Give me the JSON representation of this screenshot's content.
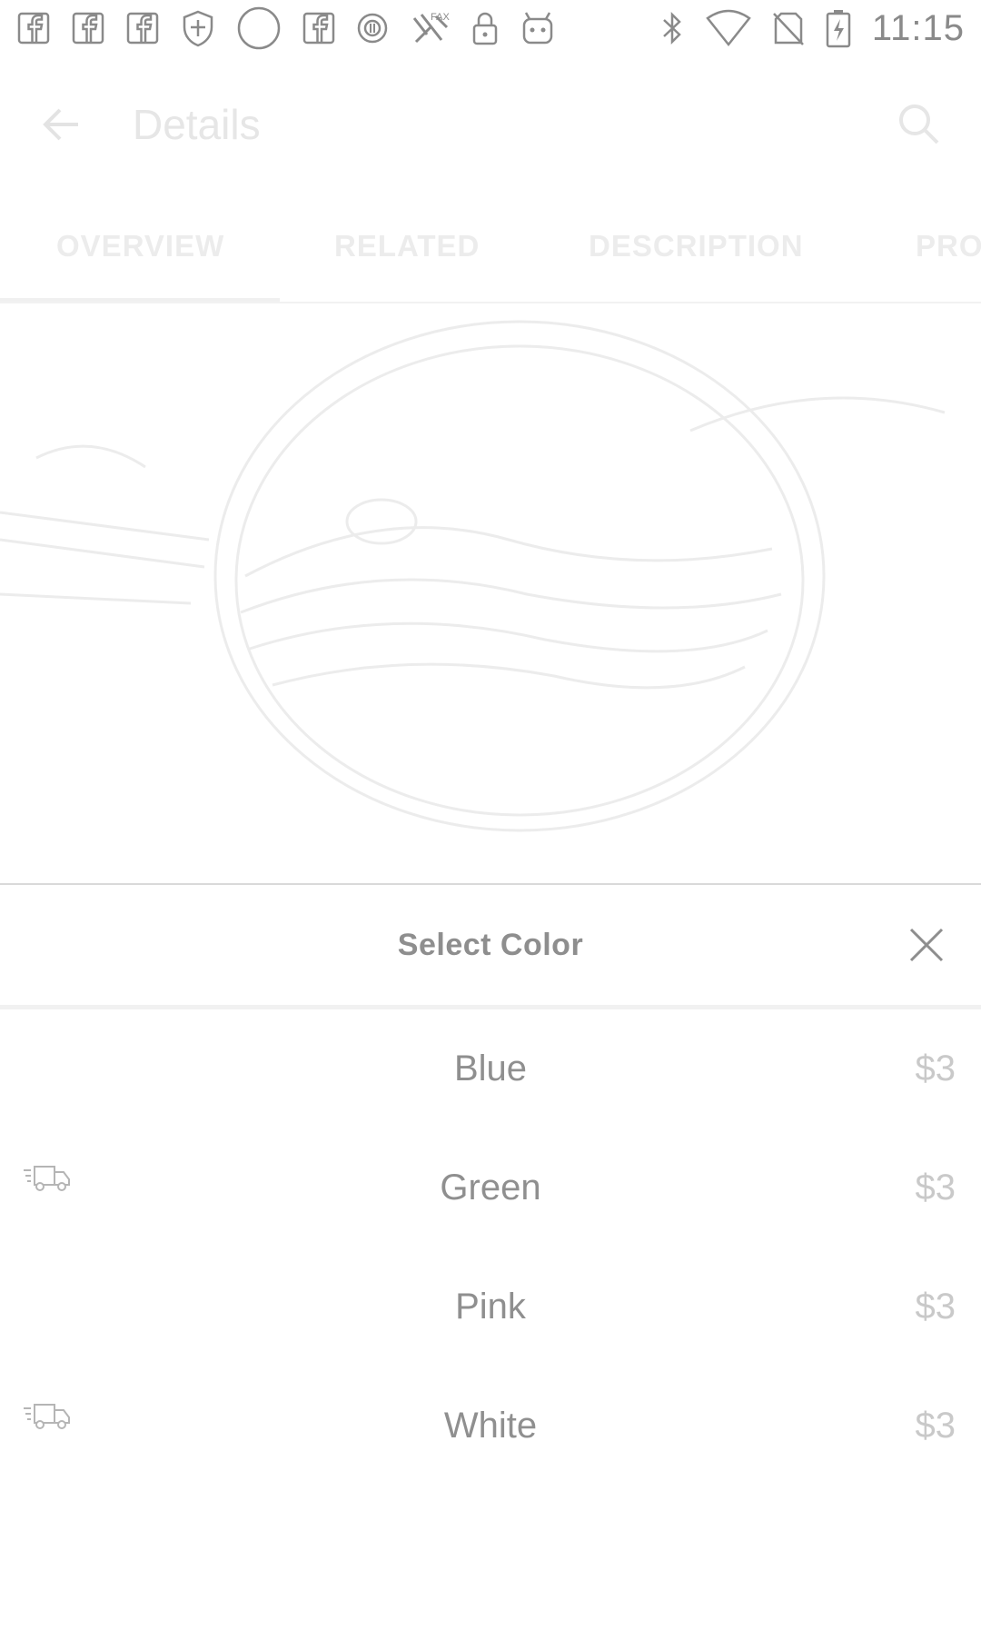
{
  "status_bar": {
    "time": "11:15",
    "left_icons": [
      "facebook-icon",
      "facebook-icon",
      "facebook-icon",
      "shield-icon",
      "circle-icon",
      "facebook-icon",
      "record-icon",
      "fax-icon",
      "lock-icon",
      "android-icon"
    ],
    "right_icons": [
      "bluetooth-icon",
      "wifi-icon",
      "no-sim-icon",
      "battery-charging-icon"
    ]
  },
  "app_bar": {
    "title": "Details"
  },
  "tabs": [
    {
      "label": "OVERVIEW",
      "selected": true
    },
    {
      "label": "RELATED",
      "selected": false
    },
    {
      "label": "DESCRIPTION",
      "selected": false
    },
    {
      "label": "PRO",
      "selected": false
    }
  ],
  "sheet": {
    "title": "Select Color",
    "options": [
      {
        "label": "Blue",
        "price": "$3",
        "fast_shipping": false
      },
      {
        "label": "Green",
        "price": "$3",
        "fast_shipping": true
      },
      {
        "label": "Pink",
        "price": "$3",
        "fast_shipping": false
      },
      {
        "label": "White",
        "price": "$3",
        "fast_shipping": true
      }
    ]
  }
}
